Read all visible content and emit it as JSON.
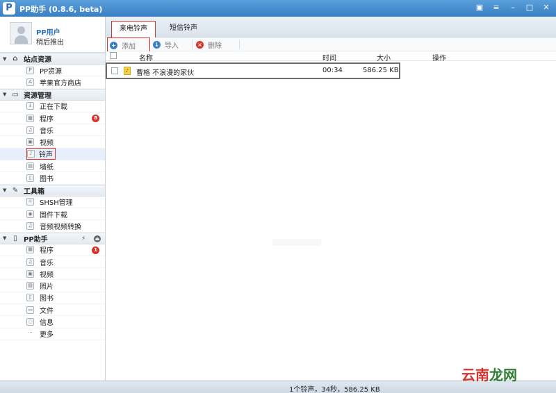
{
  "window": {
    "title": "PP助手 (0.8.6, beta)",
    "logo": "P"
  },
  "user": {
    "name": "PP用户",
    "subtitle": "稍后推出"
  },
  "sidebar": {
    "sections": [
      {
        "title": "站点资源",
        "icon": "home-icon",
        "items": [
          {
            "label": "PP资源",
            "icon": "pp-icon"
          },
          {
            "label": "苹果官方商店",
            "icon": "appstore-icon"
          }
        ]
      },
      {
        "title": "资源管理",
        "icon": "monitor-icon",
        "items": [
          {
            "label": "正在下载",
            "icon": "download-icon"
          },
          {
            "label": "程序",
            "icon": "apps-icon",
            "badge": "8"
          },
          {
            "label": "音乐",
            "icon": "music-icon"
          },
          {
            "label": "视频",
            "icon": "video-icon"
          },
          {
            "label": "铃声",
            "icon": "ringtone-icon"
          },
          {
            "label": "墙纸",
            "icon": "wallpaper-icon"
          },
          {
            "label": "图书",
            "icon": "book-icon"
          }
        ]
      },
      {
        "title": "工具箱",
        "icon": "toolbox-icon",
        "items": [
          {
            "label": "SHSH管理",
            "icon": "shsh-icon"
          },
          {
            "label": "固件下载",
            "icon": "firmware-icon"
          },
          {
            "label": "音频视频转换",
            "icon": "convert-icon"
          }
        ]
      },
      {
        "title": "PP助手",
        "icon": "phone-icon",
        "items": [
          {
            "label": "程序",
            "icon": "apps-icon",
            "badge": "1"
          },
          {
            "label": "音乐",
            "icon": "music-icon"
          },
          {
            "label": "视频",
            "icon": "video-icon"
          },
          {
            "label": "照片",
            "icon": "photo-icon"
          },
          {
            "label": "图书",
            "icon": "book-icon"
          },
          {
            "label": "文件",
            "icon": "file-icon"
          },
          {
            "label": "信息",
            "icon": "message-icon"
          },
          {
            "label": "更多",
            "icon": "more-icon"
          }
        ]
      }
    ]
  },
  "tabs": {
    "incoming": "来电铃声",
    "sms": "短信铃声"
  },
  "toolbar": {
    "add": "添加",
    "import": "导入",
    "delete": "删除"
  },
  "table": {
    "columns": {
      "name": "名称",
      "time": "时间",
      "size": "大小",
      "action": "操作"
    },
    "rows": [
      {
        "name": "曹格 不浪漫的家伙",
        "time": "00:34",
        "size": "586.25 KB"
      }
    ]
  },
  "status": "1个铃声，34秒，586.25 KB",
  "watermark": {
    "part1": "云南",
    "part2": "龙网"
  }
}
